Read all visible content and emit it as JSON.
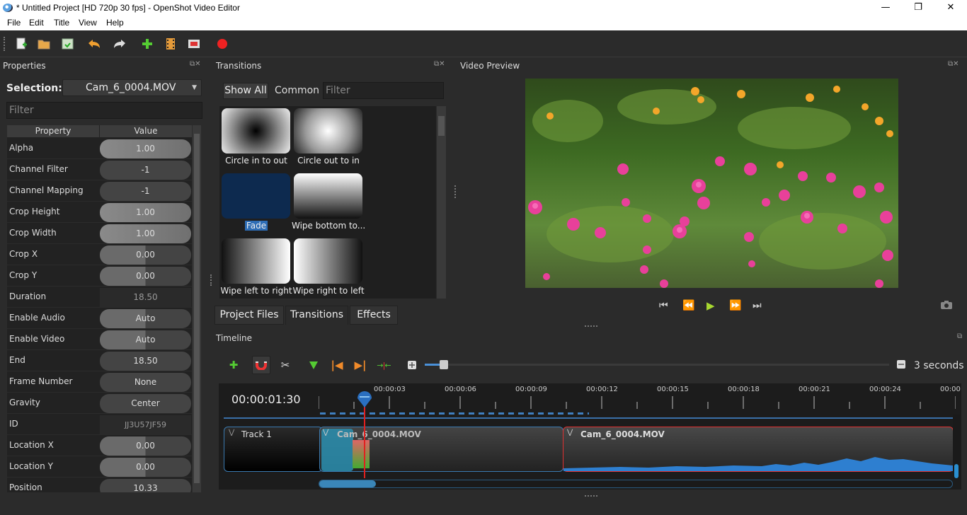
{
  "window": {
    "title": "* Untitled Project [HD 720p 30 fps] - OpenShot Video Editor",
    "minimize": "—",
    "maximize": "❐",
    "close": "✕"
  },
  "menu": [
    "File",
    "Edit",
    "Title",
    "View",
    "Help"
  ],
  "toolbar": [
    "new-project-icon",
    "open-project-icon",
    "save-project-icon",
    "undo-icon",
    "redo-icon",
    "import-files-icon",
    "profile-icon",
    "fullscreen-icon",
    "export-video-icon"
  ],
  "properties": {
    "title": "Properties",
    "selection_label": "Selection:",
    "selection_value": "Cam_6_0004.MOV",
    "filter_placeholder": "Filter",
    "col_property": "Property",
    "col_value": "Value",
    "rows": [
      {
        "name": "Alpha",
        "value": "1.00"
      },
      {
        "name": "Channel Filter",
        "value": "-1"
      },
      {
        "name": "Channel Mapping",
        "value": "-1"
      },
      {
        "name": "Crop Height",
        "value": "1.00"
      },
      {
        "name": "Crop Width",
        "value": "1.00"
      },
      {
        "name": "Crop X",
        "value": "0.00"
      },
      {
        "name": "Crop Y",
        "value": "0.00"
      },
      {
        "name": "Duration",
        "value": "18.50"
      },
      {
        "name": "Enable Audio",
        "value": "Auto"
      },
      {
        "name": "Enable Video",
        "value": "Auto"
      },
      {
        "name": "End",
        "value": "18.50"
      },
      {
        "name": "Frame Number",
        "value": "None"
      },
      {
        "name": "Gravity",
        "value": "Center"
      },
      {
        "name": "ID",
        "value": "JJ3U57JF59"
      },
      {
        "name": "Location X",
        "value": "0.00"
      },
      {
        "name": "Location Y",
        "value": "0.00"
      },
      {
        "name": "Position",
        "value": "10.33"
      }
    ]
  },
  "transitions": {
    "title": "Transitions",
    "show_all": "Show All",
    "common": "Common",
    "filter_placeholder": "Filter",
    "items": [
      {
        "label": "Circle in to out"
      },
      {
        "label": "Circle out to in"
      },
      {
        "label": "Fade"
      },
      {
        "label": "Wipe bottom to..."
      },
      {
        "label": "Wipe left to right"
      },
      {
        "label": "Wipe right to left"
      }
    ]
  },
  "tabs": [
    "Project Files",
    "Transitions",
    "Effects"
  ],
  "preview": {
    "title": "Video Preview"
  },
  "timeline": {
    "title": "Timeline",
    "timecode": "00:00:01:30",
    "zoom_label": "3 seconds",
    "ticks": [
      "00:00:03",
      "00:00:06",
      "00:00:09",
      "00:00:12",
      "00:00:15",
      "00:00:18",
      "00:00:21",
      "00:00:24",
      "00:00"
    ],
    "track_name": "Track 1",
    "clip1_name": "Cam_6_0004.MOV",
    "clip2_name": "Cam_6_0004.MOV"
  }
}
